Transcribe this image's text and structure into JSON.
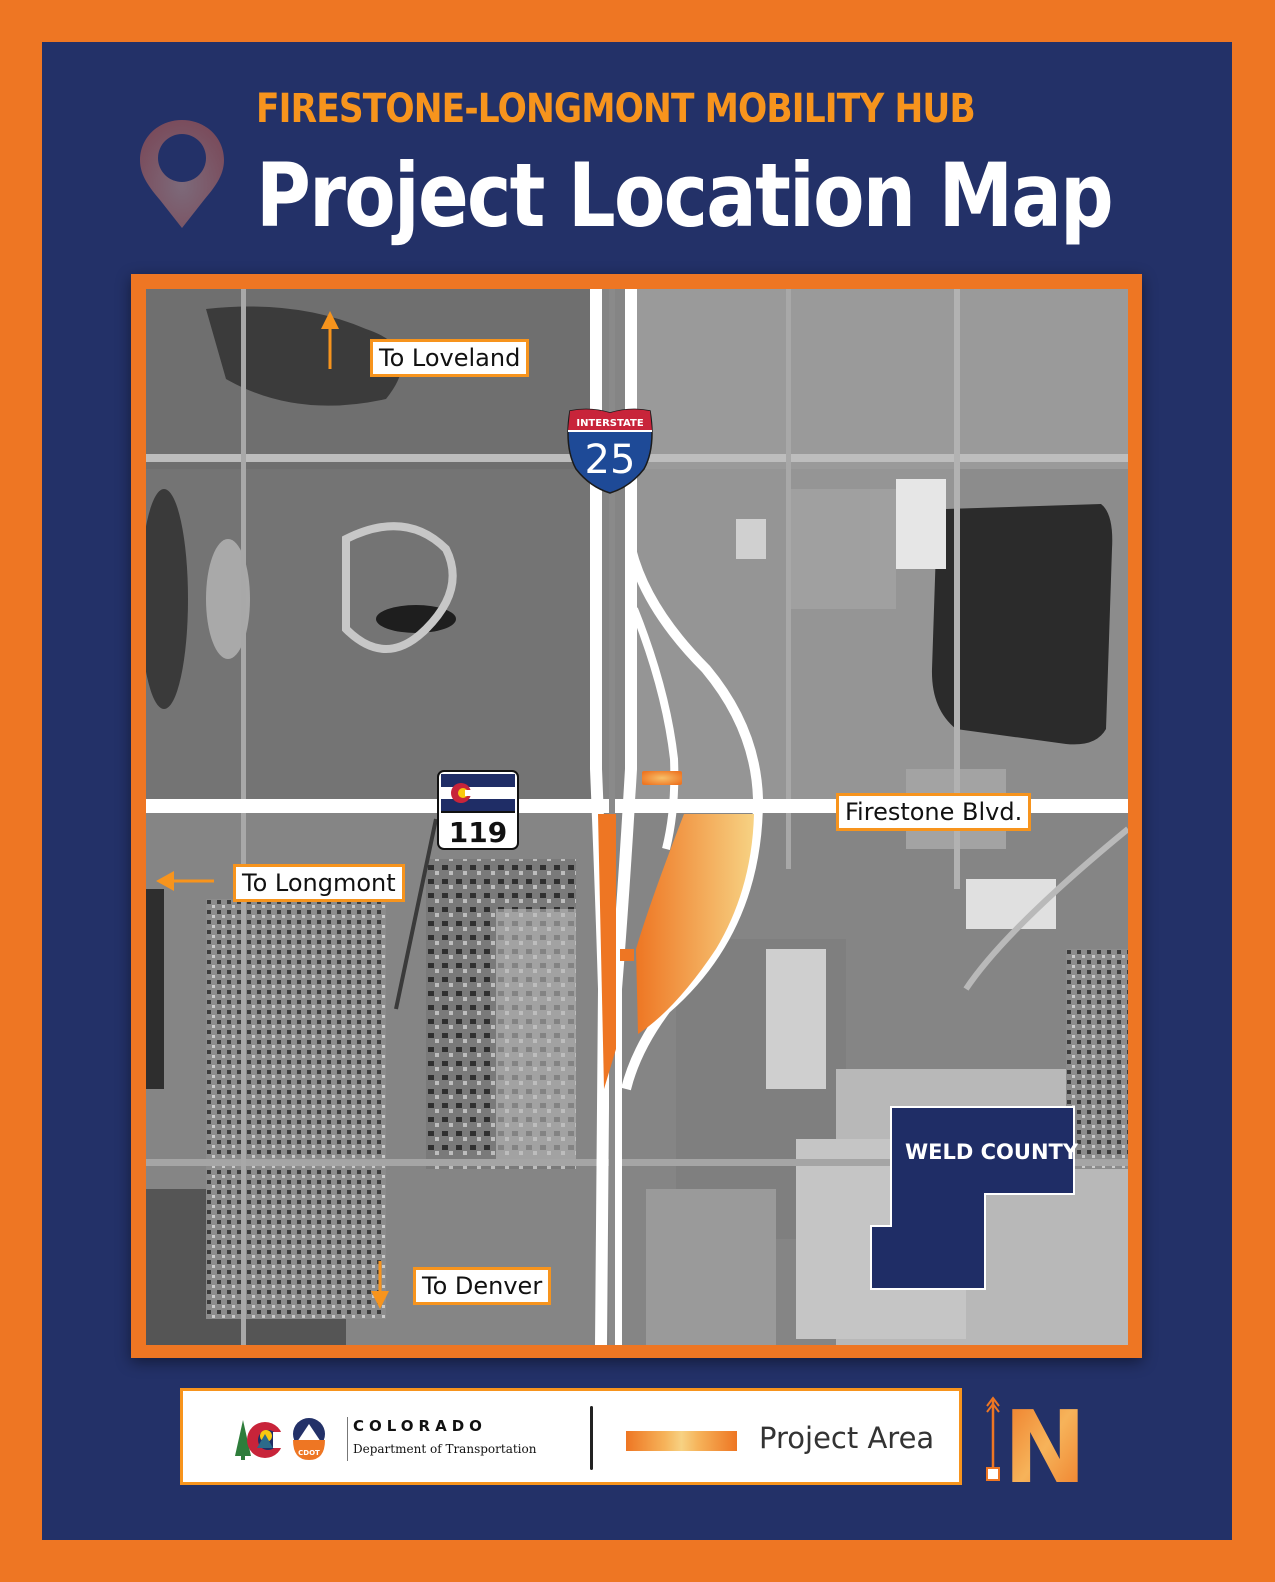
{
  "header": {
    "subtitle": "FIRESTONE-LONGMONT MOBILITY HUB",
    "title": "Project Location Map",
    "pin_icon": "location-pin-icon"
  },
  "colors": {
    "frame_orange": "#ee7623",
    "panel_navy": "#233168",
    "accent_orange": "#f7941d",
    "project_area_gradient": [
      "#ee7623",
      "#f7d283"
    ],
    "weld_county_fill": "#1f2d66"
  },
  "map": {
    "labels": {
      "to_loveland": "To Loveland",
      "to_longmont": "To Longmont",
      "to_denver": "To Denver",
      "firestone_blvd": "Firestone  Blvd."
    },
    "interstate_shield": {
      "top": "INTERSTATE",
      "number": "25"
    },
    "state_highway_shield": {
      "number": "119"
    },
    "county_label": "WELD COUNTY",
    "arrows": {
      "to_loveland": "north",
      "to_longmont": "west",
      "to_denver": "south"
    }
  },
  "legend": {
    "agency_name": "COLORADO",
    "agency_dept": "Department of Transportation",
    "agency_badge": "CDOT",
    "project_area_label": "Project Area",
    "north_label": "N"
  }
}
